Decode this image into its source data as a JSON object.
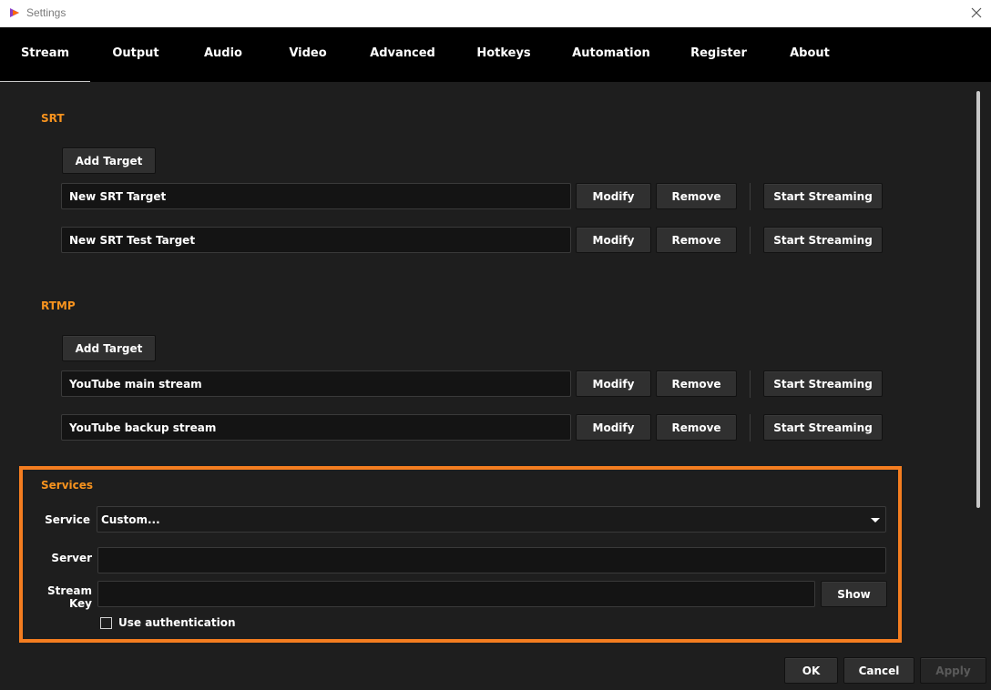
{
  "window": {
    "title": "Settings"
  },
  "tabs": [
    {
      "label": "Stream",
      "active": true
    },
    {
      "label": "Output"
    },
    {
      "label": "Audio"
    },
    {
      "label": "Video"
    },
    {
      "label": "Advanced"
    },
    {
      "label": "Hotkeys"
    },
    {
      "label": "Automation"
    },
    {
      "label": "Register"
    },
    {
      "label": "About"
    }
  ],
  "srt": {
    "title": "SRT",
    "add_label": "Add Target",
    "targets": [
      {
        "name": "New SRT Target",
        "modify": "Modify",
        "remove": "Remove",
        "start": "Start Streaming"
      },
      {
        "name": "New SRT Test Target",
        "modify": "Modify",
        "remove": "Remove",
        "start": "Start Streaming"
      }
    ]
  },
  "rtmp": {
    "title": "RTMP",
    "add_label": "Add Target",
    "targets": [
      {
        "name": "YouTube main stream",
        "modify": "Modify",
        "remove": "Remove",
        "start": "Start Streaming"
      },
      {
        "name": "YouTube backup stream",
        "modify": "Modify",
        "remove": "Remove",
        "start": "Start Streaming"
      }
    ]
  },
  "services": {
    "title": "Services",
    "service_label": "Service",
    "service_value": "Custom...",
    "server_label": "Server",
    "server_value": "",
    "key_label": "Stream Key",
    "key_value": "",
    "show_label": "Show",
    "auth_label": "Use authentication",
    "auth_checked": false
  },
  "footer": {
    "ok": "OK",
    "cancel": "Cancel",
    "apply": "Apply"
  },
  "colors": {
    "accent": "#f7931e",
    "highlight_frame": "#f47d20",
    "background": "#1e1e1e",
    "tabbar": "#000000"
  }
}
